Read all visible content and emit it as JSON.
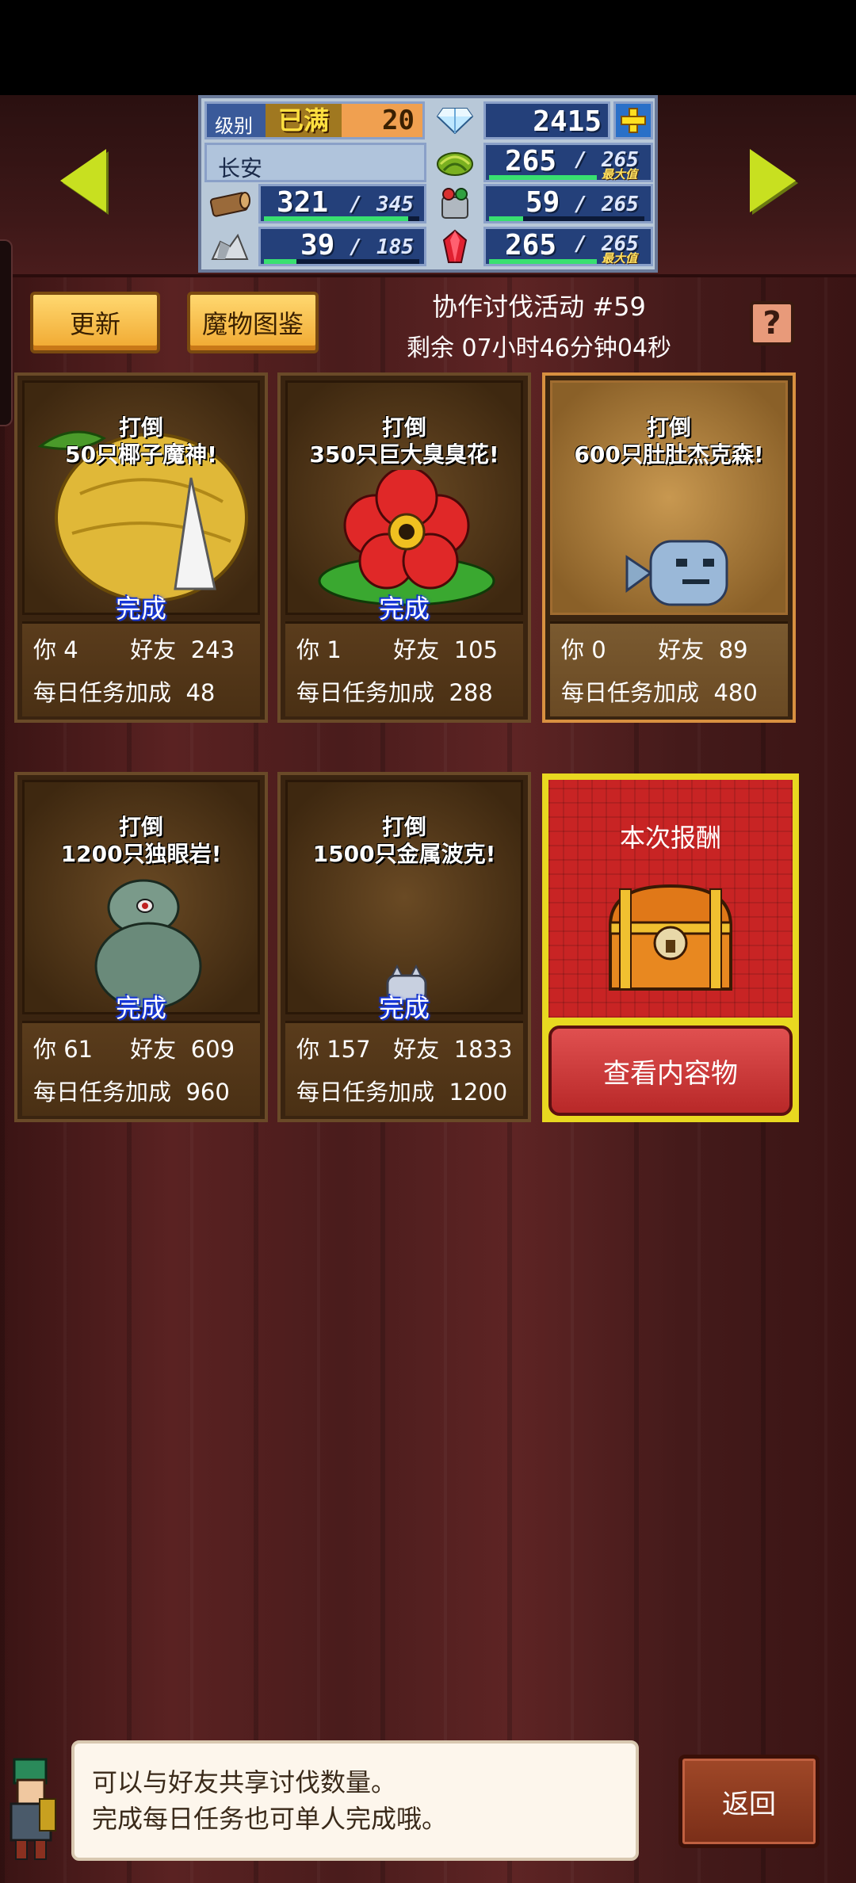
{
  "status_panel": {
    "level_label": "级别",
    "level_max_tag": "已满",
    "level_value": "20",
    "gems": "2415",
    "town_name": "长安",
    "grass": {
      "current": "265",
      "max": "265",
      "tag": "最大值",
      "fill": 1.0
    },
    "wood": {
      "current": "321",
      "max": "345",
      "fill": 0.93
    },
    "food": {
      "current": "59",
      "max": "265",
      "fill": 0.22
    },
    "ore": {
      "current": "39",
      "max": "185",
      "fill": 0.21
    },
    "crystal": {
      "current": "265",
      "max": "265",
      "tag": "最大值",
      "fill": 1.0
    }
  },
  "toolbar": {
    "refresh_label": "更新",
    "bestiary_label": "魔物图鉴",
    "event_title": "协作讨伐活动 #59",
    "event_timer": "剩余 07小时46分钟04秒",
    "help_label": "?"
  },
  "cards": [
    {
      "goal_line1": "打倒",
      "goal_line2": "50只椰子魔神!",
      "done": "完成",
      "you_label": "你",
      "you": "4",
      "friends_label": "好友",
      "friends": "243",
      "bonus_label": "每日任务加成",
      "bonus": "48"
    },
    {
      "goal_line1": "打倒",
      "goal_line2": "350只巨大臭臭花!",
      "done": "完成",
      "you_label": "你",
      "you": "1",
      "friends_label": "好友",
      "friends": "105",
      "bonus_label": "每日任务加成",
      "bonus": "288"
    },
    {
      "goal_line1": "打倒",
      "goal_line2": "600只肚肚杰克森!",
      "done": "",
      "you_label": "你",
      "you": "0",
      "friends_label": "好友",
      "friends": "89",
      "bonus_label": "每日任务加成",
      "bonus": "480"
    },
    {
      "goal_line1": "打倒",
      "goal_line2": "1200只独眼岩!",
      "done": "完成",
      "you_label": "你",
      "you": "61",
      "friends_label": "好友",
      "friends": "609",
      "bonus_label": "每日任务加成",
      "bonus": "960"
    },
    {
      "goal_line1": "打倒",
      "goal_line2": "1500只金属波克!",
      "done": "完成",
      "you_label": "你",
      "you": "157",
      "friends_label": "好友",
      "friends": "1833",
      "bonus_label": "每日任务加成",
      "bonus": "1200"
    }
  ],
  "reward": {
    "title": "本次报酬",
    "view_label": "查看内容物"
  },
  "dialog": {
    "line1": "可以与好友共享讨伐数量。",
    "line2": "完成每日任务也可单人完成哦。"
  },
  "back_label": "返回",
  "colors": {
    "accent_yellow": "#f0a830",
    "gauge_green": "#38e070",
    "panel_blue": "#24407a",
    "reward_red": "#c82424"
  }
}
